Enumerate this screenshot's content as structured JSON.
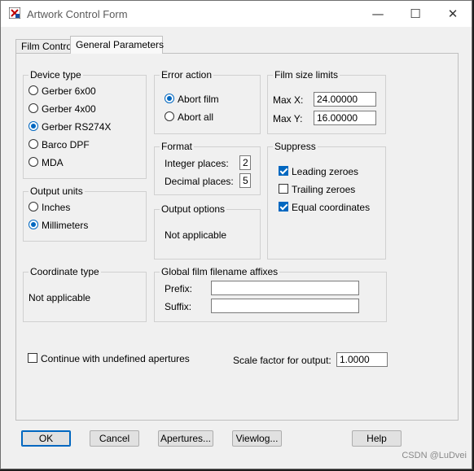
{
  "window": {
    "title": "Artwork Control Form",
    "minimize": "—",
    "maximize": "☐",
    "close": "✕"
  },
  "tabs": [
    {
      "label": "Film Control"
    },
    {
      "label": "General Parameters"
    }
  ],
  "device_type": {
    "label": "Device type",
    "options": [
      "Gerber 6x00",
      "Gerber 4x00",
      "Gerber RS274X",
      "Barco DPF",
      "MDA"
    ],
    "selected": "Gerber RS274X"
  },
  "error_action": {
    "label": "Error action",
    "options": [
      "Abort film",
      "Abort all"
    ],
    "selected": "Abort film"
  },
  "film_size_limits": {
    "label": "Film size limits",
    "max_x_label": "Max X:",
    "max_x": "24.00000",
    "max_y_label": "Max Y:",
    "max_y": "16.00000"
  },
  "format": {
    "label": "Format",
    "integer_label": "Integer places:",
    "integer_places": "2",
    "decimal_label": "Decimal places:",
    "decimal_places": "5"
  },
  "suppress": {
    "label": "Suppress",
    "leading": "Leading zeroes",
    "leading_checked": true,
    "trailing": "Trailing zeroes",
    "trailing_checked": false,
    "equal": "Equal coordinates",
    "equal_checked": true
  },
  "output_units": {
    "label": "Output units",
    "options": [
      "Inches",
      "Millimeters"
    ],
    "selected": "Millimeters"
  },
  "output_options": {
    "label": "Output options",
    "value": "Not applicable"
  },
  "coordinate_type": {
    "label": "Coordinate type",
    "value": "Not applicable"
  },
  "affixes": {
    "label": "Global film filename affixes",
    "prefix_label": "Prefix:",
    "prefix": "",
    "suffix_label": "Suffix:",
    "suffix": ""
  },
  "continue_undefined": {
    "label": "Continue with undefined apertures",
    "checked": false
  },
  "scale": {
    "label": "Scale factor for output:",
    "value": "1.0000"
  },
  "buttons": {
    "ok": "OK",
    "cancel": "Cancel",
    "apertures": "Apertures...",
    "viewlog": "Viewlog...",
    "help": "Help"
  },
  "watermark": "CSDN @LuDvei",
  "colors": {
    "accent": "#0067c0",
    "face": "#f0f0f0"
  }
}
